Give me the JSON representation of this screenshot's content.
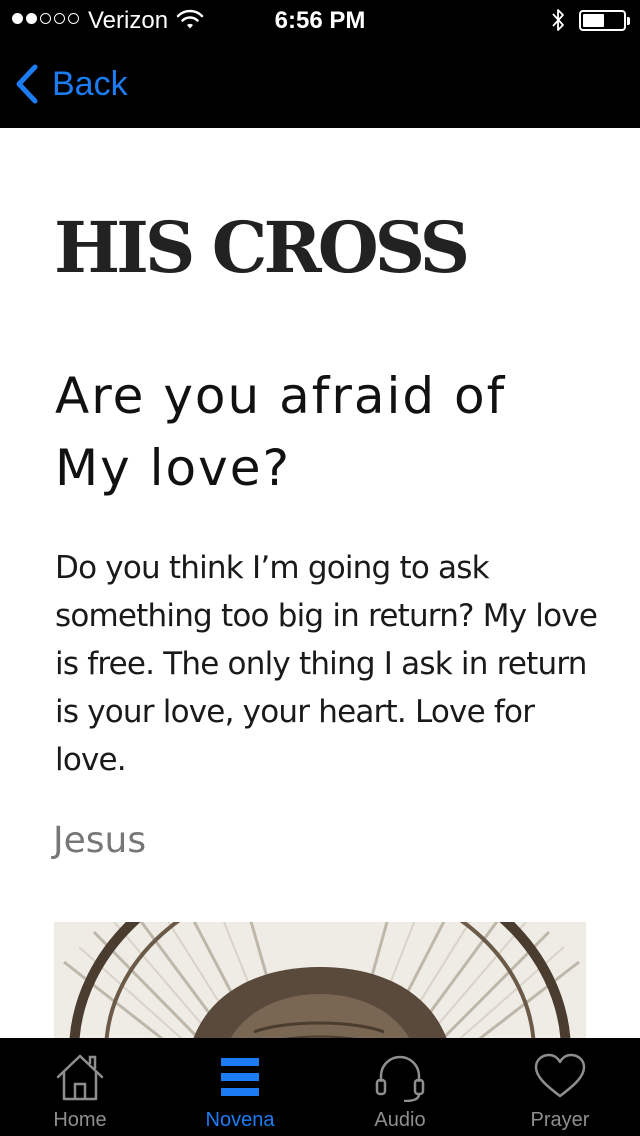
{
  "status_bar": {
    "carrier": "Verizon",
    "time": "6:56 PM",
    "signal_bars_filled": 2,
    "signal_bars_total": 5,
    "battery_level": 0.55
  },
  "nav": {
    "back_label": "Back",
    "back_icon": "chevron-left-icon"
  },
  "article": {
    "title": "HIS CROSS",
    "subtitle": "Are you afraid of My love?",
    "body": "Do you think I’m going to ask something too big in return? My love is free. The only thing I ask in return is your love, your heart. Love for love.",
    "author": "Jesus"
  },
  "tabs": [
    {
      "label": "Home",
      "icon": "home-icon",
      "active": false
    },
    {
      "label": "Novena",
      "icon": "list-icon",
      "active": true
    },
    {
      "label": "Audio",
      "icon": "headset-icon",
      "active": false
    },
    {
      "label": "Prayer",
      "icon": "heart-icon",
      "active": false
    }
  ],
  "colors": {
    "accent": "#1c7cf4",
    "bar_background": "#000000",
    "inactive_tab": "#8e8e8e",
    "content_background": "#ffffff"
  }
}
